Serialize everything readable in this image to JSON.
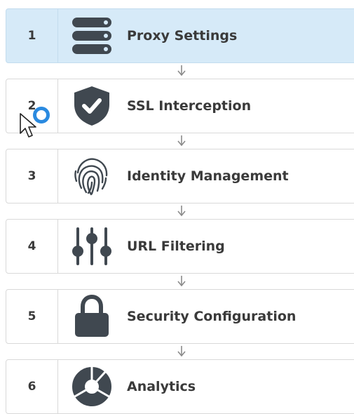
{
  "steps": [
    {
      "number": "1",
      "label": "Proxy Settings",
      "icon": "server-icon",
      "active": true
    },
    {
      "number": "2",
      "label": "SSL Interception",
      "icon": "shield-check-icon",
      "active": false
    },
    {
      "number": "3",
      "label": "Identity Management",
      "icon": "fingerprint-icon",
      "active": false
    },
    {
      "number": "4",
      "label": "URL Filtering",
      "icon": "sliders-icon",
      "active": false
    },
    {
      "number": "5",
      "label": "Security Configuration",
      "icon": "lock-icon",
      "active": false
    },
    {
      "number": "6",
      "label": "Analytics",
      "icon": "pie-chart-icon",
      "active": false
    }
  ],
  "colors": {
    "active_bg": "#d6eaf8",
    "text": "#3a3a3a",
    "icon": "#404850",
    "spinner": "#2a8ae0"
  }
}
